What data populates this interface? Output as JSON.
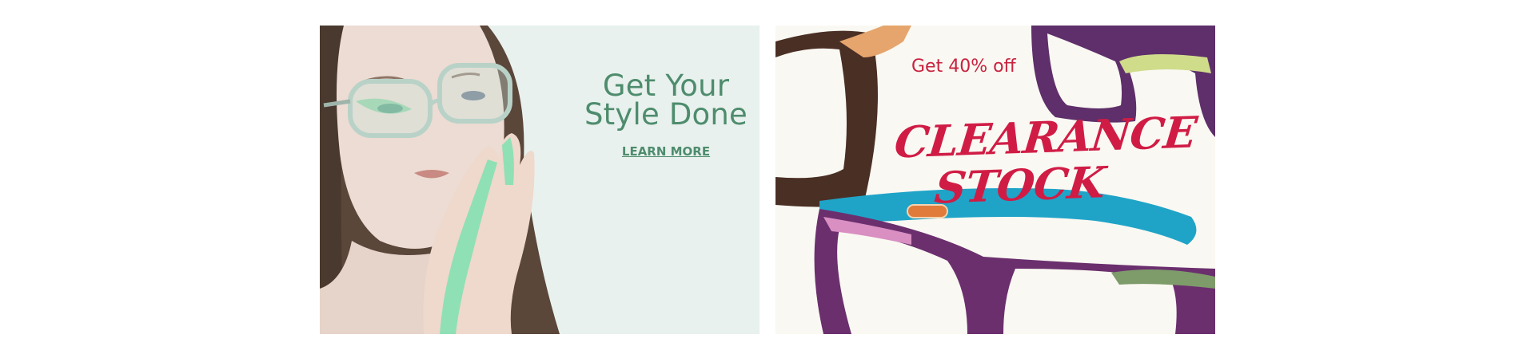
{
  "banners": {
    "left": {
      "title_line1": "Get Your",
      "title_line2": "Style Done",
      "link_label": "LEARN MORE",
      "accent_color": "#4e8c6d",
      "background_color": "#e8f1ee"
    },
    "right": {
      "offer": "Get 40% off",
      "headline_line1": "CLEARANCE",
      "headline_line2": "STOCK",
      "accent_color": "#d01c45",
      "background_color": "#faf8f2"
    }
  }
}
